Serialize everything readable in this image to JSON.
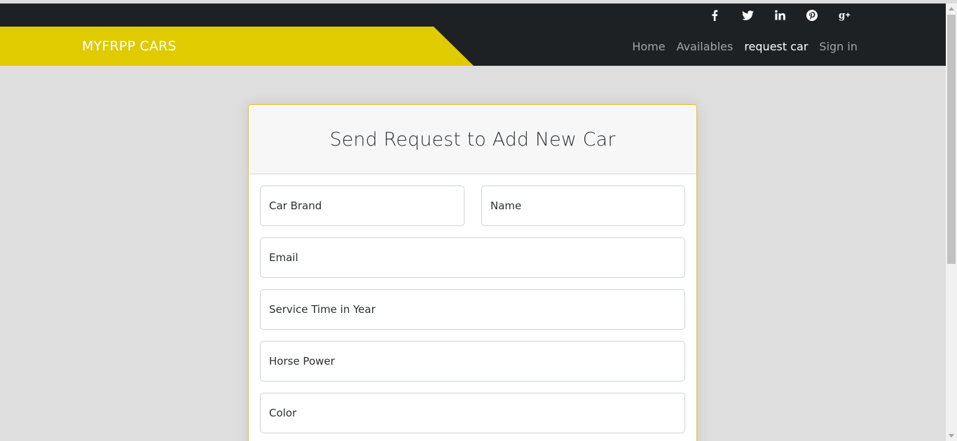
{
  "social": {
    "icons": [
      {
        "name": "facebook-icon"
      },
      {
        "name": "twitter-icon"
      },
      {
        "name": "linkedin-icon"
      },
      {
        "name": "pinterest-icon"
      },
      {
        "name": "google-plus-icon"
      }
    ]
  },
  "navbar": {
    "brand": "MYFRPP CARS",
    "links": [
      {
        "label": "Home",
        "active": false
      },
      {
        "label": "Availables",
        "active": false
      },
      {
        "label": "request car",
        "active": true
      },
      {
        "label": "Sign in",
        "active": false
      }
    ]
  },
  "form": {
    "title": "Send Request to Add New Car",
    "fields": {
      "car_brand": {
        "placeholder": "Car Brand",
        "value": ""
      },
      "name": {
        "placeholder": "Name",
        "value": ""
      },
      "email": {
        "placeholder": "Email",
        "value": ""
      },
      "service_time": {
        "placeholder": "Service Time in Year",
        "value": ""
      },
      "horse_power": {
        "placeholder": "Horse Power",
        "value": ""
      },
      "color": {
        "placeholder": "Color",
        "value": ""
      }
    }
  },
  "colors": {
    "brand_yellow": "#e0cb00",
    "navbar_dark": "#1e2124",
    "page_bg": "#dedede",
    "card_border": "#f0c419"
  }
}
